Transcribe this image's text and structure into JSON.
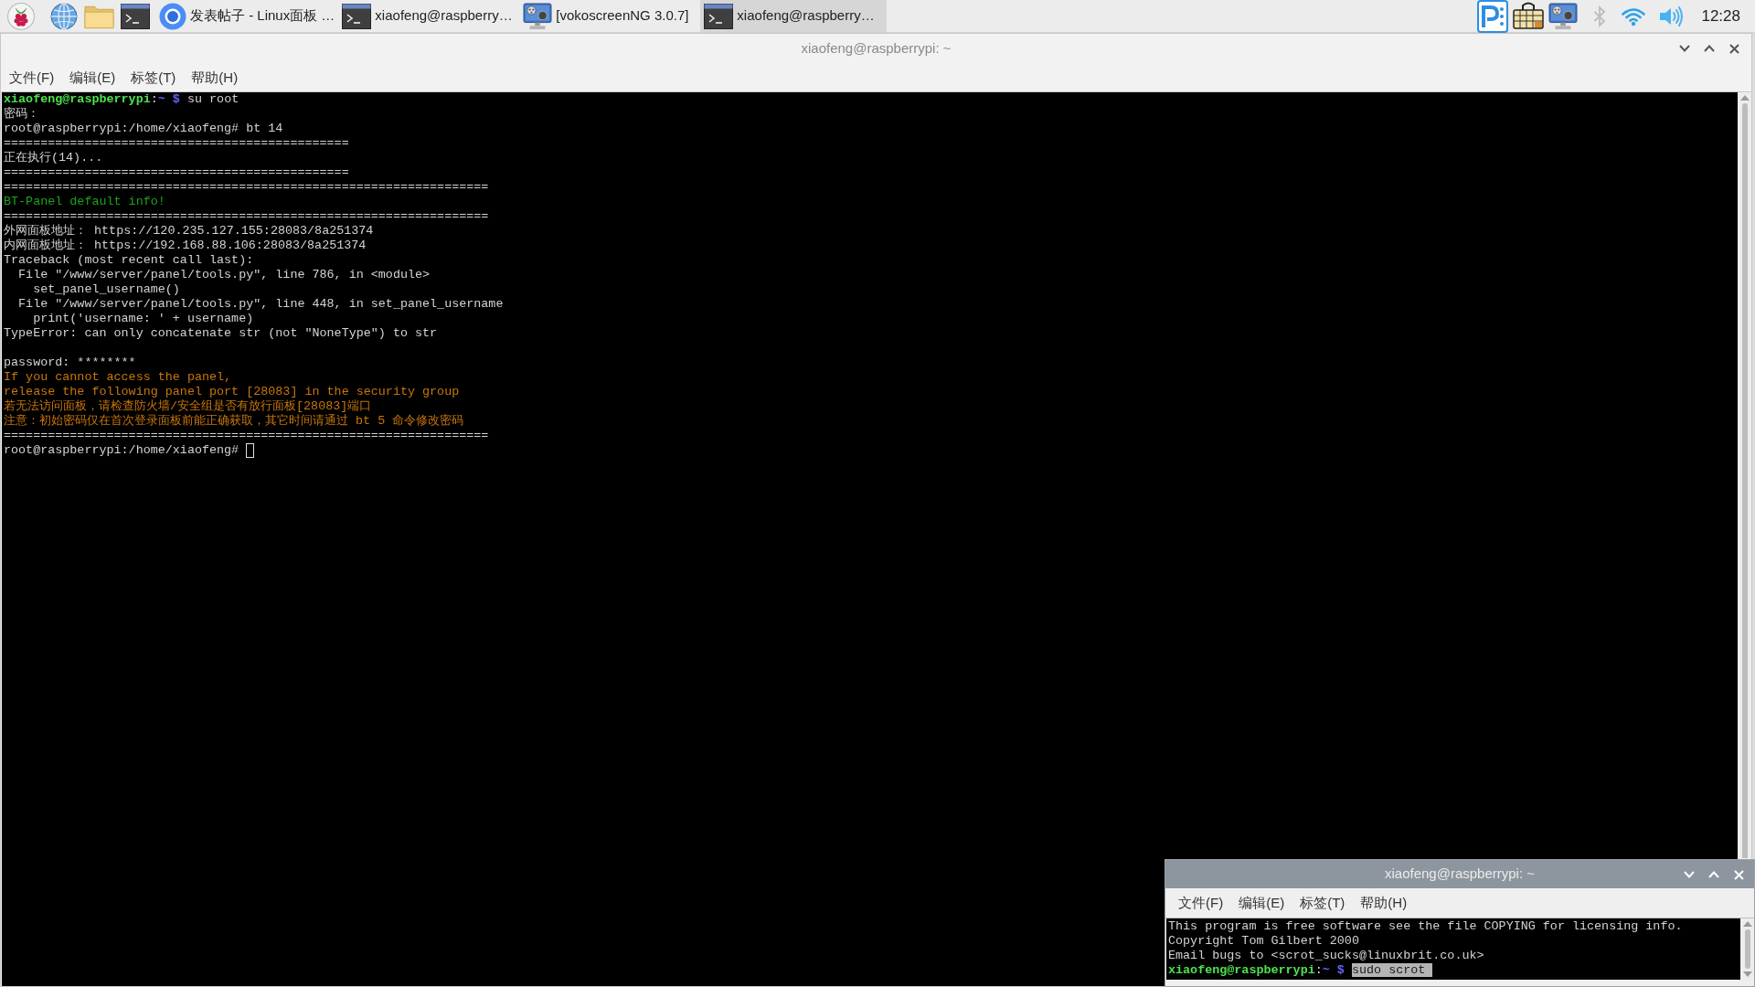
{
  "taskbar": {
    "launchers": [
      {
        "kind": "raspberry_menu"
      },
      {
        "kind": "web_browser"
      },
      {
        "kind": "file_manager"
      },
      {
        "kind": "terminal"
      }
    ],
    "tasks": [
      {
        "kind": "browser",
        "label": "发表帖子 - Linux面板 …",
        "selected": false
      },
      {
        "kind": "terminal",
        "label": "xiaofeng@raspberry…",
        "selected": false
      },
      {
        "kind": "recorder",
        "label": "[vokoscreenNG 3.0.7]",
        "selected": false
      },
      {
        "kind": "terminal",
        "label": "xiaofeng@raspberry…",
        "selected": true
      }
    ],
    "tray": [
      {
        "kind": "vnc"
      },
      {
        "kind": "keyboard"
      },
      {
        "kind": "recorder"
      },
      {
        "kind": "bluetooth"
      },
      {
        "kind": "wifi"
      },
      {
        "kind": "volume"
      }
    ],
    "clock": "12:28"
  },
  "main_window": {
    "title": "xiaofeng@raspberrypi: ~",
    "menu": [
      "文件(F)",
      "编辑(E)",
      "标签(T)",
      "帮助(H)"
    ],
    "terminal": {
      "cursor": true,
      "lines": [
        {
          "kind": "prompt",
          "user": "xiaofeng@raspberrypi",
          "separator": ":",
          "path": "~",
          "symbol": "$",
          "command": "su root"
        },
        {
          "kind": "plain",
          "text": "密码："
        },
        {
          "kind": "plain",
          "text": "root@raspberrypi:/home/xiaofeng# bt 14"
        },
        {
          "kind": "plain",
          "text": "==============================================="
        },
        {
          "kind": "plain",
          "text": "正在执行(14)..."
        },
        {
          "kind": "plain",
          "text": "==============================================="
        },
        {
          "kind": "plain",
          "text": "=================================================================="
        },
        {
          "kind": "success",
          "text": "BT-Panel default info!"
        },
        {
          "kind": "plain",
          "text": "=================================================================="
        },
        {
          "kind": "plain",
          "text": "外网面板地址： https://120.235.127.155:28083/8a251374"
        },
        {
          "kind": "plain",
          "text": "内网面板地址： https://192.168.88.106:28083/8a251374"
        },
        {
          "kind": "plain",
          "text": "Traceback (most recent call last):"
        },
        {
          "kind": "plain",
          "text": "  File \"/www/server/panel/tools.py\", line 786, in <module>"
        },
        {
          "kind": "plain",
          "text": "    set_panel_username()"
        },
        {
          "kind": "plain",
          "text": "  File \"/www/server/panel/tools.py\", line 448, in set_panel_username"
        },
        {
          "kind": "plain",
          "text": "    print('username: ' + username)"
        },
        {
          "kind": "plain",
          "text": "TypeError: can only concatenate str (not \"NoneType\") to str"
        },
        {
          "kind": "blank"
        },
        {
          "kind": "plain",
          "text": "password: ********"
        },
        {
          "kind": "warning",
          "text": "If you cannot access the panel,"
        },
        {
          "kind": "warning",
          "text": "release the following panel port [28083] in the security group"
        },
        {
          "kind": "warning",
          "text": "若无法访问面板，请检查防火墙/安全组是否有放行面板[28083]端口"
        },
        {
          "kind": "warning",
          "text": "注意：初始密码仅在首次登录面板前能正确获取，其它时间请通过 bt 5 命令修改密码"
        },
        {
          "kind": "plain",
          "text": "=================================================================="
        },
        {
          "kind": "plain",
          "text": "root@raspberrypi:/home/xiaofeng#"
        }
      ]
    }
  },
  "second_window": {
    "title": "xiaofeng@raspberrypi: ~",
    "menu": [
      "文件(F)",
      "编辑(E)",
      "标签(T)",
      "帮助(H)"
    ],
    "terminal": {
      "lines": [
        {
          "kind": "plain",
          "text": "This program is free software see the file COPYING for licensing info."
        },
        {
          "kind": "plain",
          "text": "Copyright Tom Gilbert 2000"
        },
        {
          "kind": "plain",
          "text": "Email bugs to <scrot_sucks@linuxbrit.co.uk>"
        },
        {
          "kind": "prompt",
          "user": "xiaofeng@raspberrypi",
          "separator": ":",
          "path": "~",
          "symbol": "$",
          "command": "sudo scrot",
          "command_selected": true
        }
      ]
    }
  }
}
